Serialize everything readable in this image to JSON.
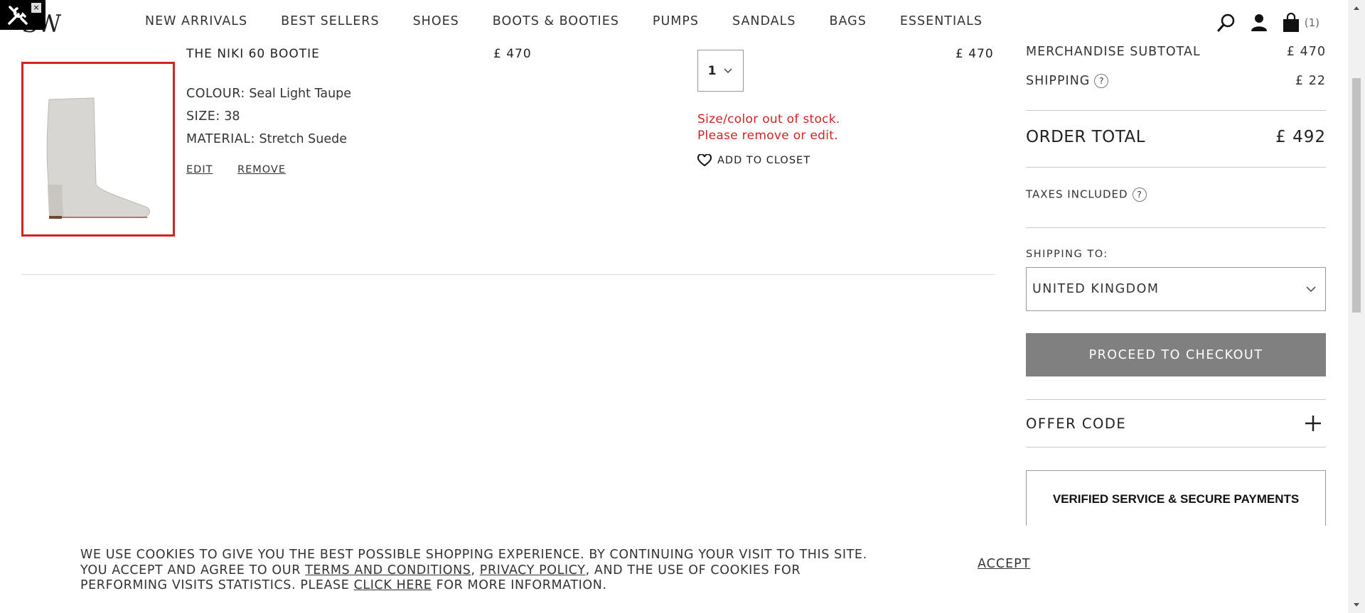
{
  "brand": {
    "logo_text": "SW"
  },
  "nav": {
    "items": [
      "NEW ARRIVALS",
      "BEST SELLERS",
      "SHOES",
      "BOOTS & BOOTIES",
      "PUMPS",
      "SANDALS",
      "BAGS",
      "ESSENTIALS"
    ],
    "cart_count": "(1)"
  },
  "cart_item": {
    "name": "THE NIKI 60 BOOTIE",
    "price": "£ 470",
    "line_total": "£ 470",
    "colour_label": "COLOUR:",
    "colour_value": "Seal Light Taupe",
    "size_label": "SIZE:",
    "size_value": "38",
    "material_label": "MATERIAL:",
    "material_value": "Stretch Suede",
    "edit_label": "EDIT",
    "remove_label": "REMOVE",
    "quantity": "1",
    "stock_msg_line1": "Size/color out of stock.",
    "stock_msg_line2": "Please remove or edit.",
    "add_to_closet_label": "ADD TO CLOSET"
  },
  "summary": {
    "subtotal_label": "MERCHANDISE SUBTOTAL",
    "subtotal_value": "£ 470",
    "shipping_label": "SHIPPING",
    "shipping_value": "£ 22",
    "order_total_label": "ORDER TOTAL",
    "order_total_value": "£ 492",
    "taxes_label": "TAXES INCLUDED",
    "help_glyph": "?",
    "shipping_to_label": "SHIPPING TO:",
    "country_value": "UNITED KINGDOM",
    "checkout_label": "PROCEED TO CHECKOUT",
    "offer_code_label": "OFFER CODE",
    "verified_label": "VERIFIED SERVICE & SECURE PAYMENTS"
  },
  "cookie_banner": {
    "text_1": "WE USE COOKIES TO GIVE YOU THE BEST POSSIBLE SHOPPING EXPERIENCE. BY CONTINUING YOUR VISIT TO THIS SITE. YOU ACCEPT AND AGREE TO OUR ",
    "terms_link": "TERMS AND CONDITIONS",
    "sep": ", ",
    "privacy_link": "PRIVACY POLICY",
    "text_2": ", AND THE USE OF COOKIES FOR PERFORMING VISITS STATISTICS. PLEASE ",
    "click_here_link": "CLICK HERE",
    "text_3": " FOR MORE INFORMATION.",
    "accept_label": "ACCEPT"
  },
  "colors": {
    "error_red": "#d42323",
    "checkout_gray": "#808080"
  },
  "icons": [
    "tools-icon",
    "close-icon",
    "search-icon",
    "account-icon",
    "shopping-bag-icon",
    "chevron-down-icon",
    "heart-icon",
    "plus-icon",
    "help-icon"
  ]
}
